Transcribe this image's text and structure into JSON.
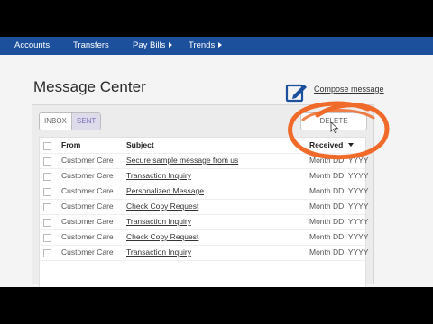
{
  "nav": {
    "items": [
      {
        "label": "Accounts",
        "has_caret": false
      },
      {
        "label": "Transfers",
        "has_caret": false
      },
      {
        "label": "Pay Bills",
        "has_caret": true
      },
      {
        "label": "Trends",
        "has_caret": true
      }
    ]
  },
  "page": {
    "title": "Message Center",
    "compose_label": "Compose message"
  },
  "tabs": {
    "inbox": "INBOX",
    "sent": "SENT",
    "selected": "SENT"
  },
  "actions": {
    "delete_label": "DELETE"
  },
  "table": {
    "headers": {
      "from": "From",
      "subject": "Subject",
      "received": "Received"
    },
    "rows": [
      {
        "from": "Customer Care",
        "subject": "Secure sample message from us",
        "received": "Month DD, YYYY"
      },
      {
        "from": "Customer Care",
        "subject": "Transaction Inquiry",
        "received": "Month DD, YYYY"
      },
      {
        "from": "Customer Care",
        "subject": "Personalized Message",
        "received": "Month DD, YYYY"
      },
      {
        "from": "Customer Care",
        "subject": "Check Copy Request",
        "received": "Month DD, YYYY"
      },
      {
        "from": "Customer Care",
        "subject": "Transaction Inquiry",
        "received": "Month DD, YYYY"
      },
      {
        "from": "Customer Care",
        "subject": "Check Copy Request",
        "received": "Month DD, YYYY"
      },
      {
        "from": "Customer Care",
        "subject": "Transaction Inquiry",
        "received": "Month DD, YYYY"
      }
    ]
  },
  "colors": {
    "nav_bar": "#1c4f9c",
    "accent_icon": "#1c4f9c",
    "annotation": "#f06a2a",
    "sent_tab": "#7a6fb8"
  }
}
